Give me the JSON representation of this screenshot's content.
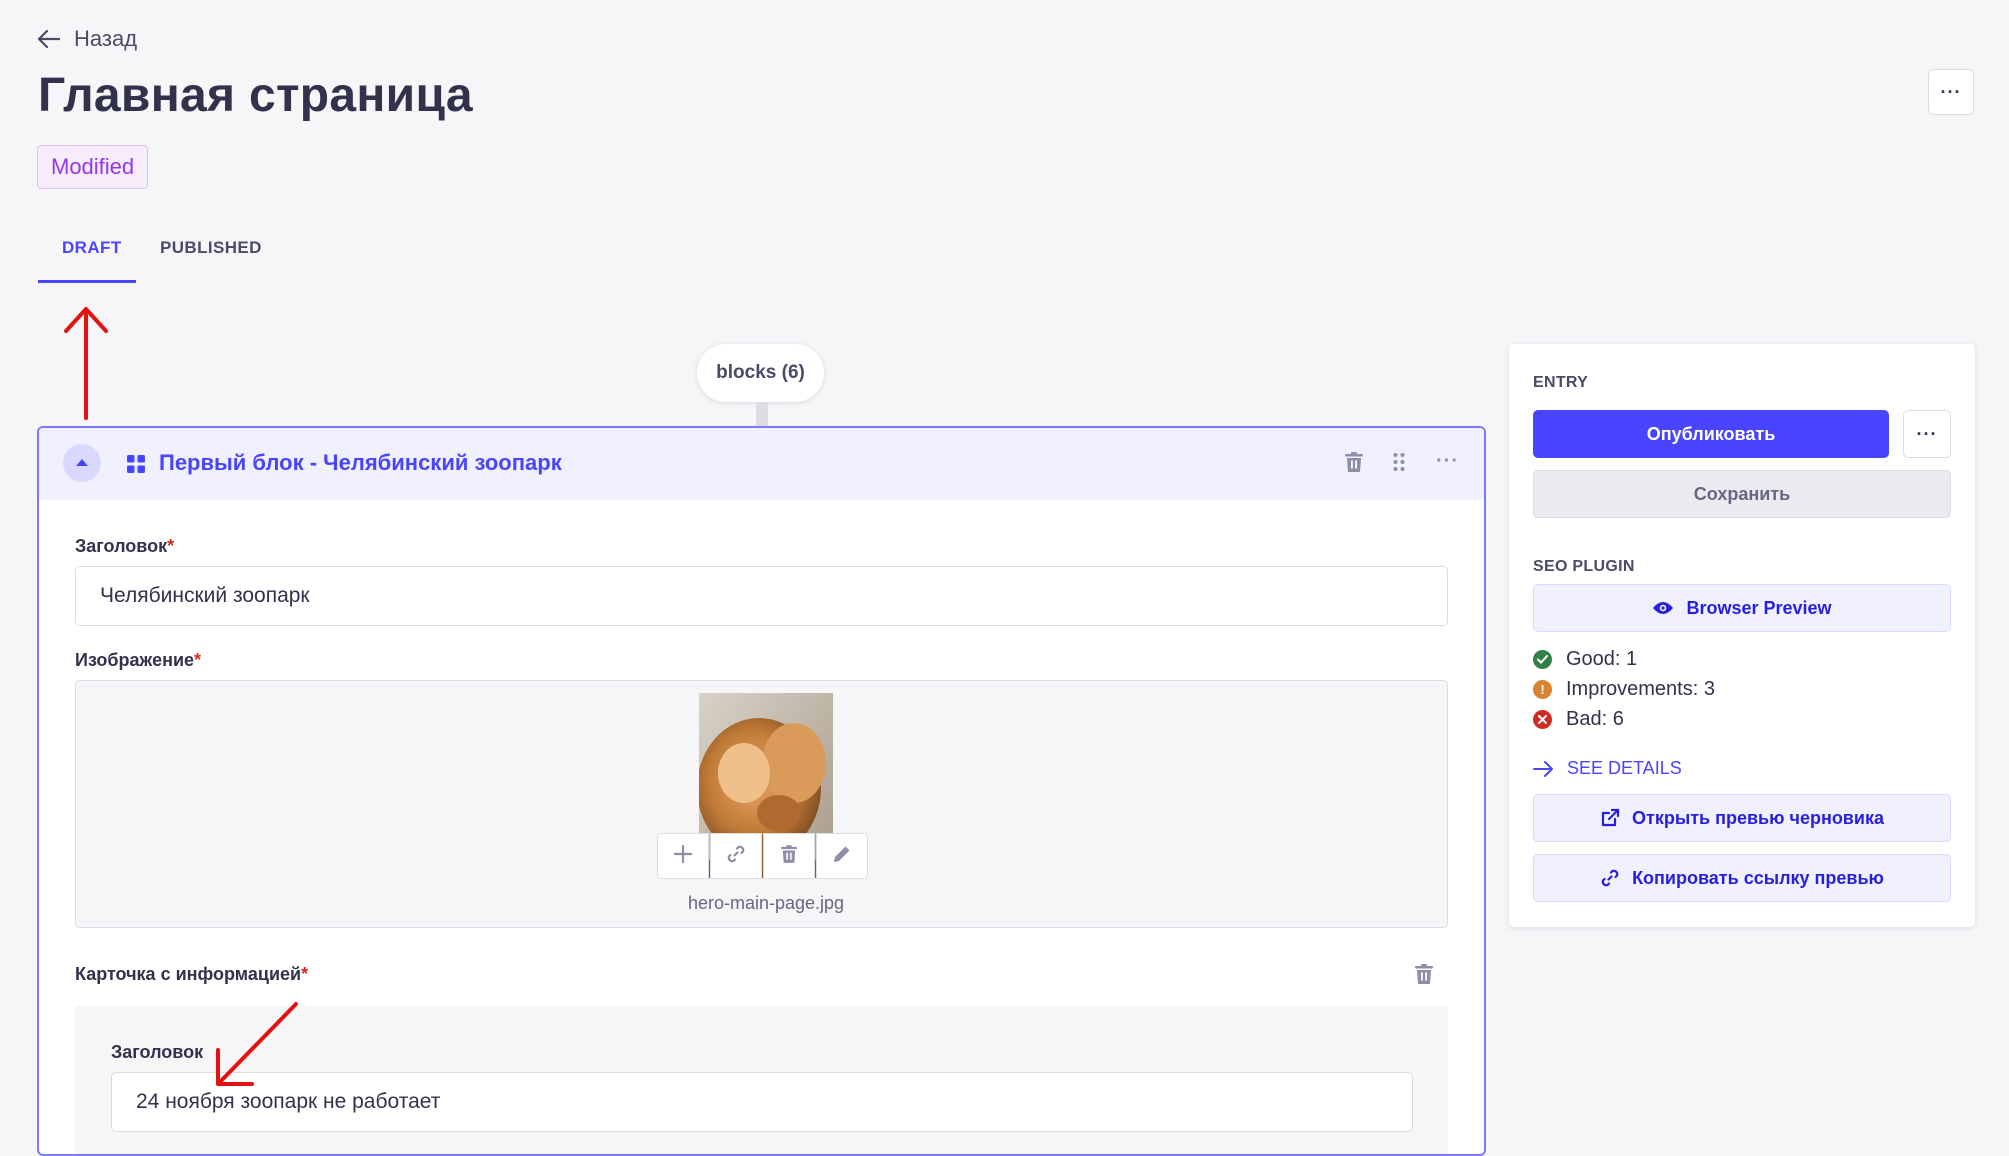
{
  "header": {
    "back_label": "Назад",
    "title": "Главная страница",
    "status_badge": "Modified"
  },
  "tabs": [
    {
      "label": "DRAFT",
      "active": true
    },
    {
      "label": "PUBLISHED",
      "active": false
    }
  ],
  "blocks_pill": "blocks (6)",
  "block": {
    "title": "Первый блок - Челябинский зоопарк",
    "fields": {
      "title_label": "Заголовок",
      "title_value": "Челябинский зоопарк",
      "image_label": "Изображение",
      "image_filename": "hero-main-page.jpg",
      "info_card_label": "Карточка с информацией",
      "info_title_label": "Заголовок",
      "info_title_value": "24 ноября зоопарк не работает"
    },
    "required_mark": "*"
  },
  "sidebar": {
    "entry_heading": "ENTRY",
    "publish_label": "Опубликовать",
    "save_label": "Сохранить",
    "seo_heading": "SEO PLUGIN",
    "browser_preview_label": "Browser Preview",
    "stats": {
      "good": "Good: 1",
      "improvements": "Improvements: 3",
      "bad": "Bad: 6"
    },
    "see_details_label": "SEE DETAILS",
    "open_draft_preview_label": "Открыть превью черновика",
    "copy_preview_link_label": "Копировать ссылку превью"
  },
  "colors": {
    "primary": "#4945ff",
    "badge_text": "#9736e8",
    "success": "#328048",
    "warning": "#d9822f",
    "danger": "#d02b20",
    "annotation_arrow": "#e4110f"
  },
  "icons": [
    "arrow-left-icon",
    "more-icon",
    "chevron-up-icon",
    "grid-icon",
    "trash-icon",
    "drag-icon",
    "plus-icon",
    "link-icon",
    "pencil-icon",
    "eye-icon",
    "check-circle-icon",
    "exclamation-circle-icon",
    "cross-circle-icon",
    "arrow-right-icon",
    "external-link-icon"
  ]
}
